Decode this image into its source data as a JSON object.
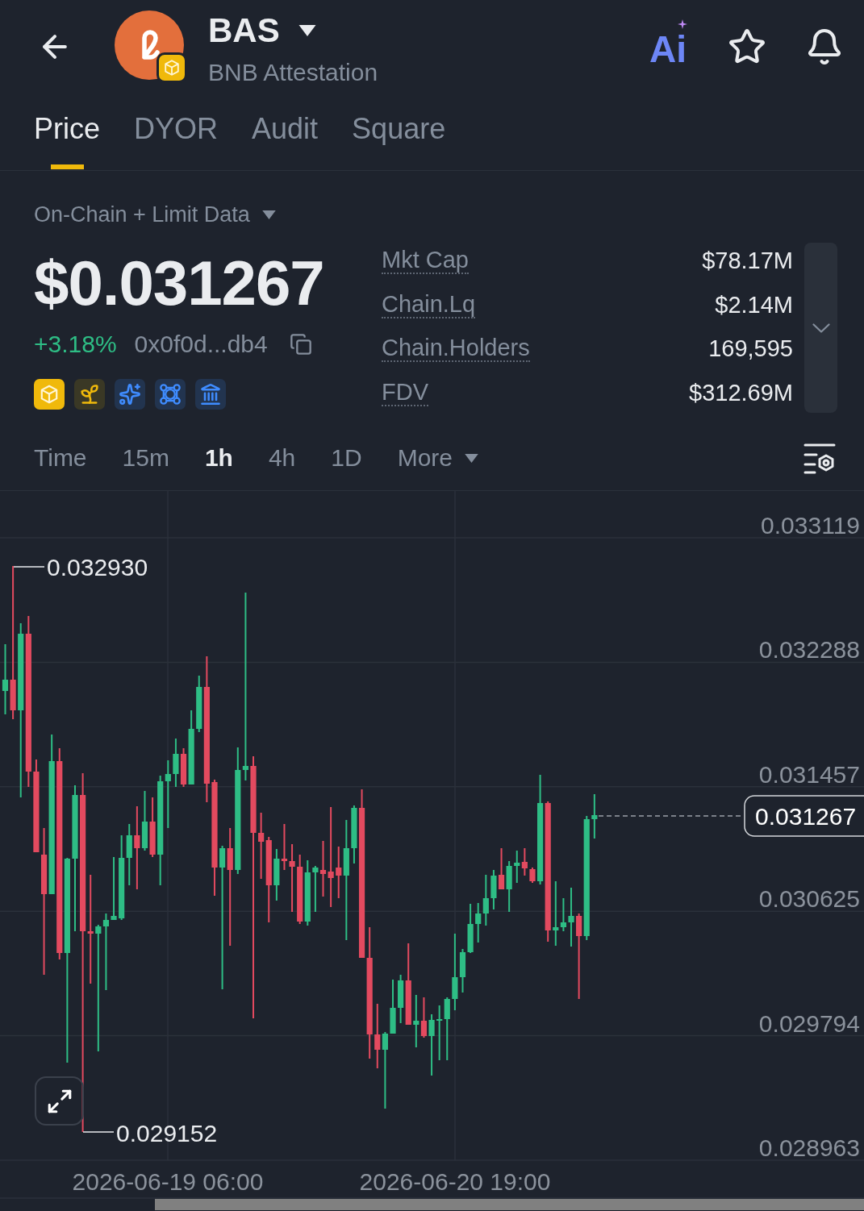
{
  "header": {
    "title": "BAS",
    "subtitle": "BNB Attestation",
    "ai_label": "Ai"
  },
  "tabs": [
    {
      "label": "Price",
      "selected": true
    },
    {
      "label": "DYOR",
      "selected": false
    },
    {
      "label": "Audit",
      "selected": false
    },
    {
      "label": "Square",
      "selected": false
    }
  ],
  "market": {
    "data_source": "On-Chain + Limit Data",
    "price": "$0.031267",
    "change": "+3.18%",
    "contract_address": "0x0f0d...db4"
  },
  "stats": [
    {
      "label": "Mkt Cap",
      "value": "$78.17M"
    },
    {
      "label": "Chain.Lq",
      "value": "$2.14M"
    },
    {
      "label": "Chain.Holders",
      "value": "169,595"
    },
    {
      "label": "FDV",
      "value": "$312.69M"
    }
  ],
  "intervals": [
    {
      "label": "Time",
      "selected": false,
      "kind": "option"
    },
    {
      "label": "15m",
      "selected": false,
      "kind": "option"
    },
    {
      "label": "1h",
      "selected": true,
      "kind": "option"
    },
    {
      "label": "4h",
      "selected": false,
      "kind": "option"
    },
    {
      "label": "1D",
      "selected": false,
      "kind": "option"
    },
    {
      "label": "More",
      "selected": false,
      "kind": "menu"
    }
  ],
  "chart": {
    "y_axis_labels": [
      "0.033119",
      "0.032288",
      "0.031457",
      "0.030625",
      "0.029794",
      "0.028963"
    ],
    "high_label": "0.032930",
    "low_label": "0.029152",
    "last_price": "0.031267",
    "x_axis_labels": [
      "2026-06-19 06:00",
      "2026-06-20 19:00"
    ]
  }
}
